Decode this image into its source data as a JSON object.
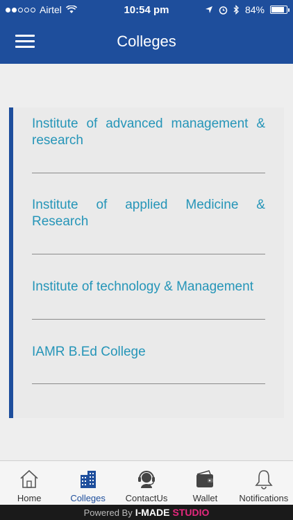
{
  "status_bar": {
    "carrier": "Airtel",
    "time": "10:54 pm",
    "battery_percent": "84%",
    "battery_level": 0.84
  },
  "header": {
    "title": "Colleges"
  },
  "colleges": [
    {
      "label": "Institute of advanced management & research"
    },
    {
      "label": "Institute of applied Medicine & Research"
    },
    {
      "label": "Institute of technology & Management"
    },
    {
      "label": "IAMR B.Ed College"
    }
  ],
  "tab_bar": {
    "items": [
      {
        "label": "Home",
        "icon": "home-icon"
      },
      {
        "label": "Colleges",
        "icon": "building-icon",
        "active": true
      },
      {
        "label": "ContactUs",
        "icon": "headset-icon"
      },
      {
        "label": "Wallet",
        "icon": "wallet-icon"
      },
      {
        "label": "Notifications",
        "icon": "bell-icon"
      }
    ]
  },
  "footer": {
    "powered_by": "Powered By",
    "brand_primary": "I-MADE",
    "brand_secondary": "STUDIO"
  },
  "colors": {
    "primary": "#1e4e9c",
    "link": "#2595b8",
    "brand_accent": "#e6287e"
  }
}
